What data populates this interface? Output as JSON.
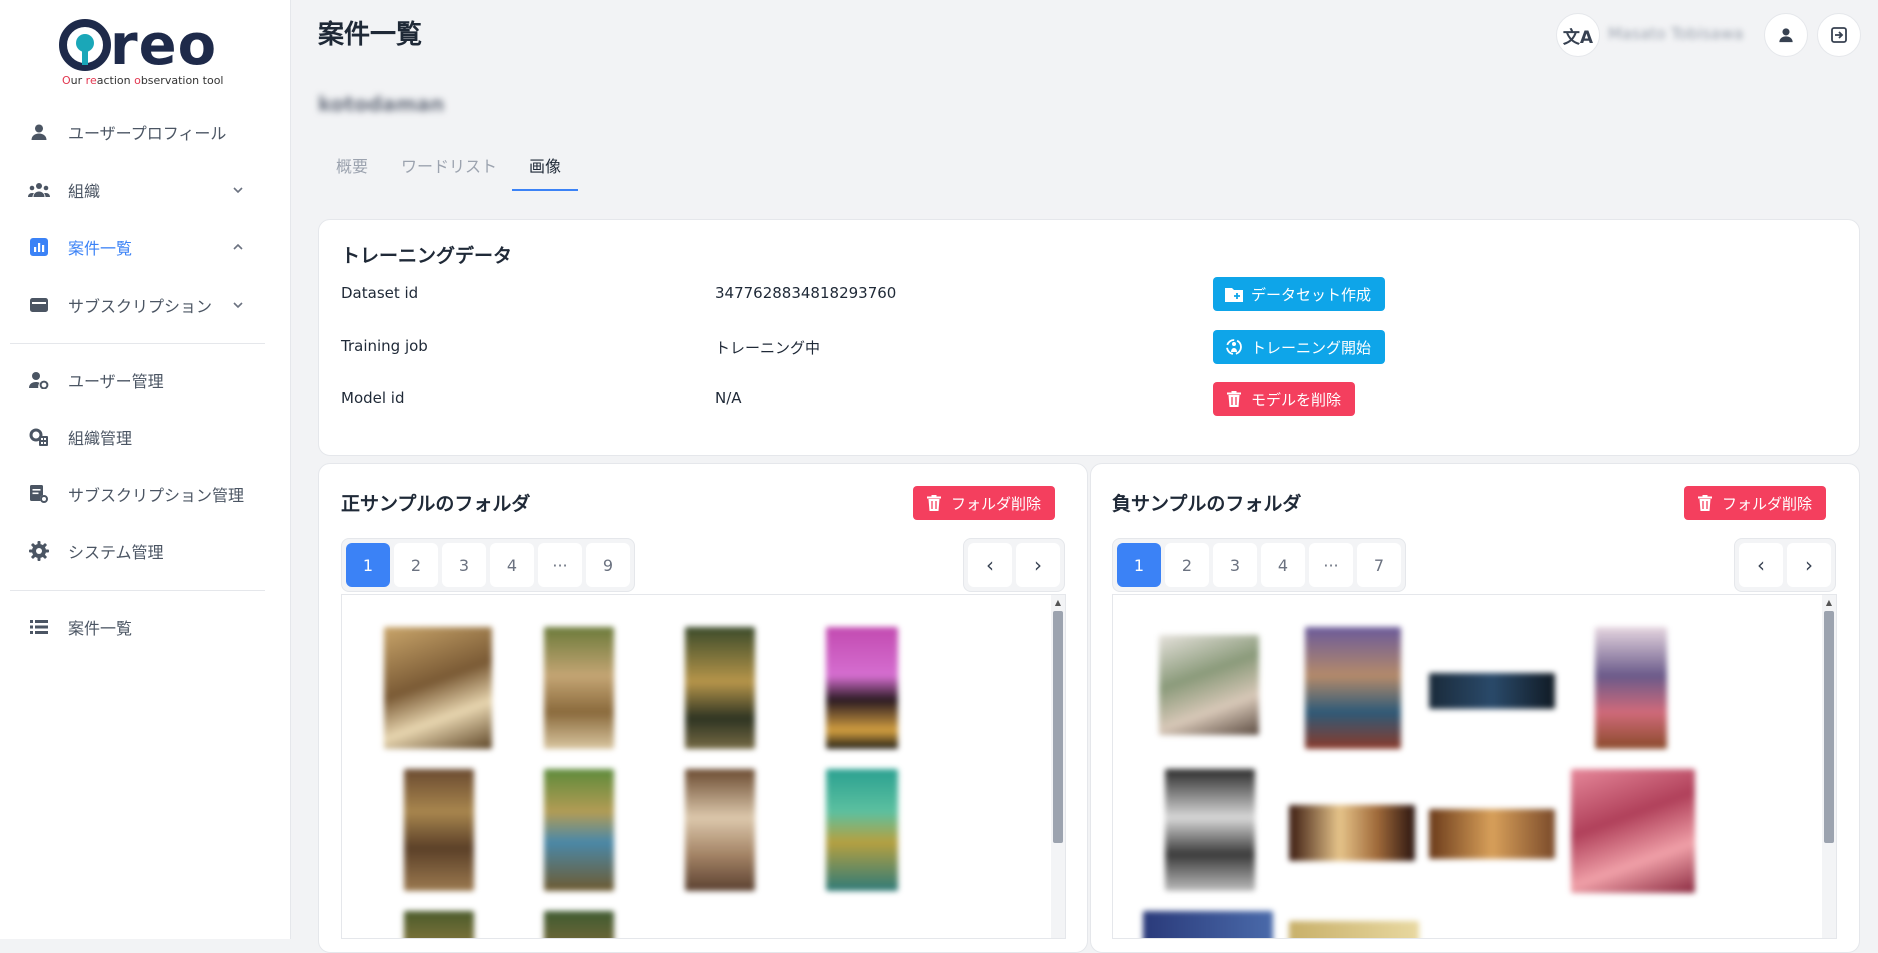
{
  "logo": {
    "word": "reo",
    "tagline_parts": [
      "O",
      "ur ",
      "re",
      "action ",
      "o",
      "bservation tool"
    ]
  },
  "sidebar": {
    "items": [
      {
        "label": "ユーザープロフィール"
      },
      {
        "label": "組織"
      },
      {
        "label": "案件一覧"
      },
      {
        "label": "サブスクリプション"
      },
      {
        "label": "ユーザー管理"
      },
      {
        "label": "組織管理"
      },
      {
        "label": "サブスクリプション管理"
      },
      {
        "label": "システム管理"
      },
      {
        "label": "案件一覧"
      }
    ]
  },
  "header": {
    "title": "案件一覧",
    "user_name": "Masato Tobisawa"
  },
  "project": {
    "name": "kotodaman"
  },
  "tabs": [
    {
      "label": "概要"
    },
    {
      "label": "ワードリスト"
    },
    {
      "label": "画像"
    }
  ],
  "training": {
    "title": "トレーニングデータ",
    "rows": [
      {
        "label": "Dataset id",
        "value": "3477628834818293760",
        "button": "データセット作成"
      },
      {
        "label": "Training job",
        "value": "トレーニング中",
        "button": "トレーニング開始"
      },
      {
        "label": "Model id",
        "value": "N/A",
        "button": "モデルを削除"
      }
    ]
  },
  "positive": {
    "title": "正サンプルのフォルダ",
    "delete_label": "フォルダ削除",
    "pages": [
      "1",
      "2",
      "3",
      "4",
      "···",
      "9"
    ],
    "active_page": "1"
  },
  "negative": {
    "title": "負サンプルのフォルダ",
    "delete_label": "フォルダ削除",
    "pages": [
      "1",
      "2",
      "3",
      "4",
      "···",
      "7"
    ],
    "active_page": "1"
  },
  "pager_arrows": {
    "prev": "‹",
    "next": "›"
  },
  "colors": {
    "accent": "#3b82f6",
    "info": "#0ea5e9",
    "danger": "#f43f5e",
    "logo_dark": "#1e2a4a",
    "logo_teal": "#1aa7b8"
  }
}
